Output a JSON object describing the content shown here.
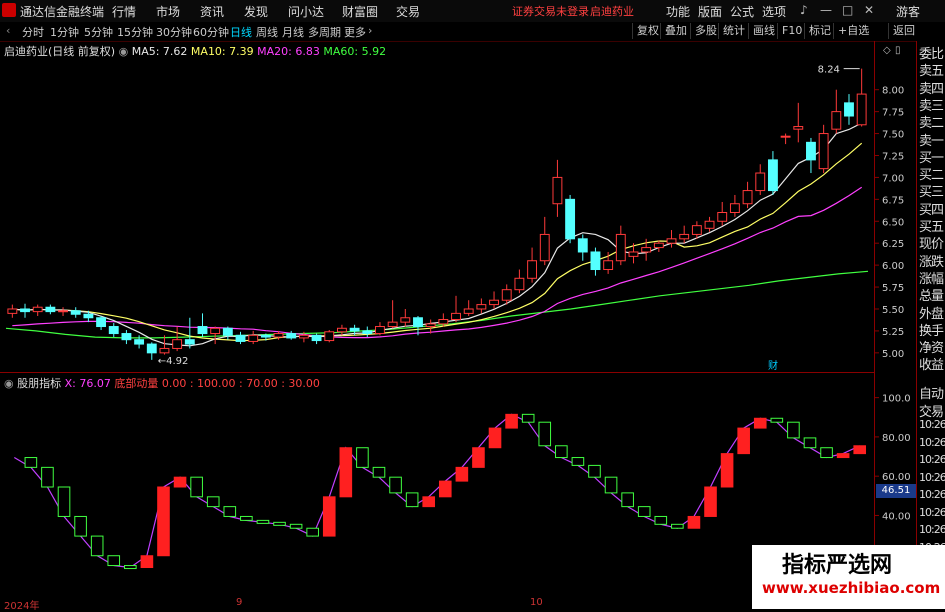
{
  "menubar": {
    "app_title": "通达信金融终端",
    "items": [
      "行情",
      "市场",
      "资讯",
      "发现",
      "问小达",
      "财富圈",
      "交易"
    ],
    "warning": "证券交易未登录",
    "stock_name": "启迪药业",
    "right_items": [
      "功能",
      "版面",
      "公式",
      "选项"
    ],
    "user": "游客"
  },
  "toolbar": {
    "periods": [
      "分时",
      "1分钟",
      "5分钟",
      "15分钟",
      "30分钟",
      "60分钟",
      "日线",
      "周线",
      "月线",
      "多周期",
      "更多"
    ],
    "active_period": "日线",
    "right_buttons": [
      "复权",
      "叠加",
      "多股",
      "统计",
      "画线",
      "F10",
      "标记",
      "+自选",
      "返回"
    ]
  },
  "main_chart": {
    "title": "启迪药业(日线 前复权)",
    "ma_labels": [
      {
        "text": "MA5: 7.62",
        "color": "#e8e8e8"
      },
      {
        "text": "MA10: 7.39",
        "color": "#ffff66"
      },
      {
        "text": "MA20: 6.83",
        "color": "#ff40ff"
      },
      {
        "text": "MA60: 5.92",
        "color": "#40ff40"
      }
    ],
    "high_annotation": "8.24",
    "low_annotation": "4.92",
    "event_marker": "财",
    "y_ticks": [
      "8.00",
      "7.75",
      "7.50",
      "7.25",
      "7.00",
      "6.75",
      "6.50",
      "6.25",
      "6.00",
      "5.75",
      "5.50",
      "5.25",
      "5.00"
    ]
  },
  "sub_chart": {
    "title": "股朋指标",
    "values_text": [
      {
        "text": "X: 76.07",
        "color": "#ff40ff"
      },
      {
        "text": "底部动量",
        "color": "#ff4040"
      },
      {
        "text": "0.00 : 100.00 : 70.00 : 30.00",
        "color": "#ff4040"
      }
    ],
    "y_ticks": [
      "100.0",
      "80.00",
      "60.00",
      "40.00"
    ],
    "current_value": "46.51"
  },
  "x_axis": {
    "labels": [
      "2024年",
      "9",
      "10"
    ]
  },
  "side_panel": {
    "items": [
      "委比",
      "卖五",
      "卖四",
      "卖三",
      "卖二",
      "卖一",
      "买一",
      "买二",
      "买三",
      "买四",
      "买五",
      "现价",
      "涨跌",
      "涨幅",
      "总量",
      "外盘",
      "换手",
      "净资",
      "收益"
    ],
    "sub_items": [
      "自动",
      "交易",
      "10:26",
      "10:26",
      "10:26",
      "10:26",
      "10:26",
      "10:26",
      "10:26",
      "10:26",
      "10:26",
      "10:26"
    ]
  },
  "watermark": {
    "title": "指标严选网",
    "url": "www.xuezhibiao.com"
  },
  "chart_data": {
    "type": "candlestick",
    "price_ylim": [
      4.85,
      8.35
    ],
    "candles": [
      {
        "o": 5.45,
        "c": 5.5,
        "h": 5.55,
        "l": 5.4
      },
      {
        "o": 5.5,
        "c": 5.47,
        "h": 5.56,
        "l": 5.4
      },
      {
        "o": 5.47,
        "c": 5.52,
        "h": 5.55,
        "l": 5.42
      },
      {
        "o": 5.52,
        "c": 5.47,
        "h": 5.55,
        "l": 5.44
      },
      {
        "o": 5.47,
        "c": 5.48,
        "h": 5.52,
        "l": 5.42
      },
      {
        "o": 5.48,
        "c": 5.44,
        "h": 5.52,
        "l": 5.4
      },
      {
        "o": 5.44,
        "c": 5.4,
        "h": 5.48,
        "l": 5.35
      },
      {
        "o": 5.4,
        "c": 5.3,
        "h": 5.42,
        "l": 5.26
      },
      {
        "o": 5.3,
        "c": 5.22,
        "h": 5.34,
        "l": 5.18
      },
      {
        "o": 5.22,
        "c": 5.15,
        "h": 5.26,
        "l": 5.1
      },
      {
        "o": 5.15,
        "c": 5.1,
        "h": 5.2,
        "l": 5.05
      },
      {
        "o": 5.1,
        "c": 5.0,
        "h": 5.12,
        "l": 4.92
      },
      {
        "o": 5.0,
        "c": 5.05,
        "h": 5.2,
        "l": 4.98
      },
      {
        "o": 5.05,
        "c": 5.15,
        "h": 5.3,
        "l": 5.02
      },
      {
        "o": 5.15,
        "c": 5.1,
        "h": 5.4,
        "l": 5.05
      },
      {
        "o": 5.3,
        "c": 5.22,
        "h": 5.45,
        "l": 5.18
      },
      {
        "o": 5.22,
        "c": 5.28,
        "h": 5.3,
        "l": 5.1
      },
      {
        "o": 5.28,
        "c": 5.2,
        "h": 5.3,
        "l": 5.15
      },
      {
        "o": 5.2,
        "c": 5.13,
        "h": 5.24,
        "l": 5.1
      },
      {
        "o": 5.13,
        "c": 5.2,
        "h": 5.25,
        "l": 5.1
      },
      {
        "o": 5.2,
        "c": 5.18,
        "h": 5.22,
        "l": 5.14
      },
      {
        "o": 5.18,
        "c": 5.22,
        "h": 5.25,
        "l": 5.15
      },
      {
        "o": 5.22,
        "c": 5.17,
        "h": 5.25,
        "l": 5.15
      },
      {
        "o": 5.17,
        "c": 5.2,
        "h": 5.24,
        "l": 5.12
      },
      {
        "o": 5.2,
        "c": 5.14,
        "h": 5.22,
        "l": 5.1
      },
      {
        "o": 5.14,
        "c": 5.24,
        "h": 5.26,
        "l": 5.12
      },
      {
        "o": 5.24,
        "c": 5.28,
        "h": 5.32,
        "l": 5.2
      },
      {
        "o": 5.28,
        "c": 5.25,
        "h": 5.32,
        "l": 5.2
      },
      {
        "o": 5.25,
        "c": 5.22,
        "h": 5.3,
        "l": 5.18
      },
      {
        "o": 5.22,
        "c": 5.3,
        "h": 5.35,
        "l": 5.2
      },
      {
        "o": 5.3,
        "c": 5.35,
        "h": 5.6,
        "l": 5.28
      },
      {
        "o": 5.35,
        "c": 5.4,
        "h": 5.5,
        "l": 5.3
      },
      {
        "o": 5.4,
        "c": 5.3,
        "h": 5.42,
        "l": 5.2
      },
      {
        "o": 5.3,
        "c": 5.33,
        "h": 5.38,
        "l": 5.22
      },
      {
        "o": 5.33,
        "c": 5.38,
        "h": 5.45,
        "l": 5.3
      },
      {
        "o": 5.38,
        "c": 5.45,
        "h": 5.65,
        "l": 5.35
      },
      {
        "o": 5.45,
        "c": 5.5,
        "h": 5.6,
        "l": 5.42
      },
      {
        "o": 5.5,
        "c": 5.55,
        "h": 5.62,
        "l": 5.45
      },
      {
        "o": 5.55,
        "c": 5.6,
        "h": 5.7,
        "l": 5.5
      },
      {
        "o": 5.6,
        "c": 5.72,
        "h": 5.78,
        "l": 5.55
      },
      {
        "o": 5.72,
        "c": 5.85,
        "h": 5.95,
        "l": 5.68
      },
      {
        "o": 5.85,
        "c": 6.05,
        "h": 6.2,
        "l": 5.8
      },
      {
        "o": 6.05,
        "c": 6.35,
        "h": 6.55,
        "l": 6.0
      },
      {
        "o": 6.7,
        "c": 7.0,
        "h": 7.2,
        "l": 6.55
      },
      {
        "o": 6.75,
        "c": 6.3,
        "h": 6.8,
        "l": 6.25
      },
      {
        "o": 6.3,
        "c": 6.15,
        "h": 6.35,
        "l": 6.05
      },
      {
        "o": 6.15,
        "c": 5.95,
        "h": 6.2,
        "l": 5.88
      },
      {
        "o": 5.95,
        "c": 6.05,
        "h": 6.15,
        "l": 5.9
      },
      {
        "o": 6.05,
        "c": 6.35,
        "h": 6.45,
        "l": 6.0
      },
      {
        "o": 6.1,
        "c": 6.15,
        "h": 6.25,
        "l": 6.02
      },
      {
        "o": 6.15,
        "c": 6.2,
        "h": 6.3,
        "l": 6.05
      },
      {
        "o": 6.2,
        "c": 6.25,
        "h": 6.28,
        "l": 6.15
      },
      {
        "o": 6.25,
        "c": 6.3,
        "h": 6.4,
        "l": 6.2
      },
      {
        "o": 6.3,
        "c": 6.35,
        "h": 6.45,
        "l": 6.25
      },
      {
        "o": 6.35,
        "c": 6.45,
        "h": 6.5,
        "l": 6.3
      },
      {
        "o": 6.42,
        "c": 6.5,
        "h": 6.55,
        "l": 6.38
      },
      {
        "o": 6.5,
        "c": 6.6,
        "h": 6.72,
        "l": 6.45
      },
      {
        "o": 6.6,
        "c": 6.7,
        "h": 6.8,
        "l": 6.55
      },
      {
        "o": 6.7,
        "c": 6.85,
        "h": 6.95,
        "l": 6.65
      },
      {
        "o": 6.85,
        "c": 7.05,
        "h": 7.15,
        "l": 6.8
      },
      {
        "o": 7.2,
        "c": 6.85,
        "h": 7.3,
        "l": 6.8
      },
      {
        "o": 7.47,
        "c": 7.47,
        "h": 7.5,
        "l": 7.38
      },
      {
        "o": 7.55,
        "c": 7.58,
        "h": 7.85,
        "l": 7.4
      },
      {
        "o": 7.4,
        "c": 7.2,
        "h": 7.45,
        "l": 7.05
      },
      {
        "o": 7.1,
        "c": 7.5,
        "h": 7.6,
        "l": 7.05
      },
      {
        "o": 7.55,
        "c": 7.75,
        "h": 8.0,
        "l": 7.5
      },
      {
        "o": 7.85,
        "c": 7.7,
        "h": 7.95,
        "l": 7.6
      },
      {
        "o": 7.6,
        "c": 7.95,
        "h": 8.24,
        "l": 7.58
      }
    ],
    "ma60": [
      5.28,
      5.25,
      5.21,
      5.18,
      5.17,
      5.17,
      5.18,
      5.19,
      5.2,
      5.21,
      5.22,
      5.23,
      5.25,
      5.27,
      5.3,
      5.33,
      5.37,
      5.42,
      5.46,
      5.5,
      5.55,
      5.6,
      5.65,
      5.69,
      5.73,
      5.77,
      5.82,
      5.86,
      5.9,
      5.93
    ],
    "oscillator": {
      "ylim": [
        0,
        110
      ],
      "x_line": [
        70,
        65,
        55,
        40,
        30,
        20,
        15,
        14,
        20,
        55,
        60,
        50,
        45,
        40,
        38,
        37,
        36,
        34,
        30,
        50,
        75,
        65,
        60,
        52,
        45,
        50,
        58,
        65,
        75,
        85,
        92,
        88,
        76,
        70,
        66,
        60,
        52,
        45,
        40,
        36,
        34,
        40,
        55,
        72,
        85,
        90,
        88,
        80,
        75,
        70,
        72,
        76
      ]
    }
  }
}
